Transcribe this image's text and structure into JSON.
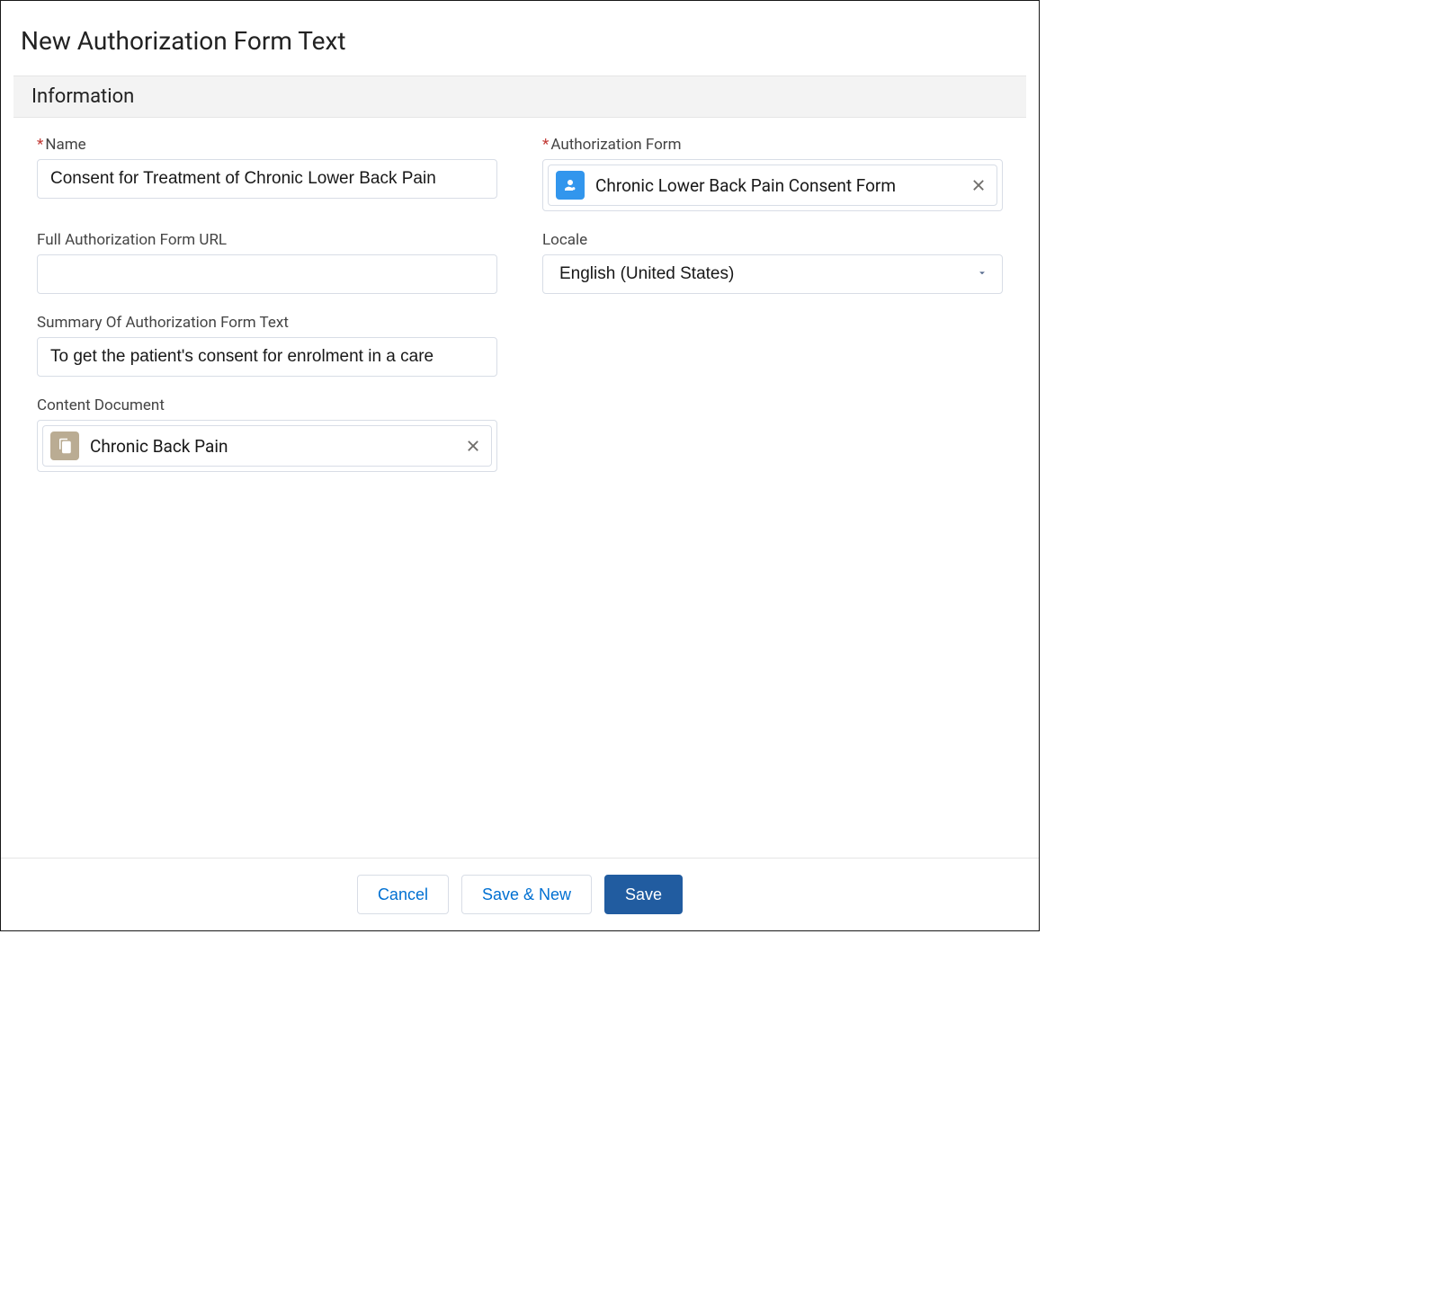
{
  "modal": {
    "title": "New Authorization Form Text"
  },
  "section": {
    "header": "Information"
  },
  "fields": {
    "name": {
      "label": "Name",
      "value": "Consent for Treatment of Chronic Lower Back Pain"
    },
    "authForm": {
      "label": "Authorization Form",
      "value": "Chronic Lower Back Pain Consent Form"
    },
    "url": {
      "label": "Full Authorization Form URL",
      "value": ""
    },
    "locale": {
      "label": "Locale",
      "value": "English (United States)"
    },
    "summary": {
      "label": "Summary Of Authorization Form Text",
      "value": "To get the patient's consent for enrolment in a care"
    },
    "contentDoc": {
      "label": "Content Document",
      "value": "Chronic Back Pain"
    }
  },
  "footer": {
    "cancel": "Cancel",
    "saveNew": "Save & New",
    "save": "Save"
  }
}
